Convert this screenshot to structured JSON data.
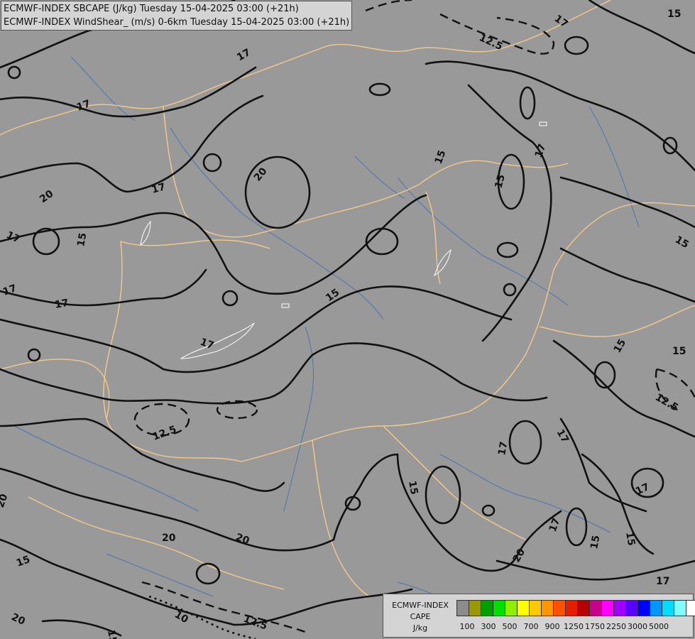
{
  "header": {
    "line1": "ECMWF-INDEX SBCAPE (J/kg) Tuesday 15-04-2025 03:00 (+21h)",
    "line2": "ECMWF-INDEX WindShear_ (m/s) 0-6km Tuesday 15-04-2025 03:00 (+21h)"
  },
  "map": {
    "background_color": "#999999",
    "border_color": "#f5c98a",
    "river_color": "#3f6fb0",
    "contour_color": "#111111",
    "contour_labels": [
      "17",
      "15",
      "12.5",
      "17",
      "17",
      "20",
      "15",
      "17",
      "17",
      "15",
      "20",
      "17",
      "15",
      "17",
      "15",
      "15",
      "17",
      "17",
      "12.5",
      "15",
      "15",
      "12.5",
      "17",
      "15",
      "17",
      "17",
      "20",
      "20",
      "20",
      "15",
      "20",
      "10",
      "12.5",
      "15",
      "20",
      "17",
      "15",
      "15",
      "17"
    ]
  },
  "legend": {
    "title_line1": "ECMWF-INDEX",
    "title_line2": "CAPE",
    "title_line3": "J/kg",
    "colors": [
      "#8c8c8c",
      "#9a9a00",
      "#00a000",
      "#00e000",
      "#90ee00",
      "#ffff00",
      "#ffc800",
      "#ff9600",
      "#ff5000",
      "#e61e00",
      "#b40000",
      "#c8008c",
      "#ff00ff",
      "#a000ff",
      "#5a00ff",
      "#0000ff",
      "#0096ff",
      "#00dcff",
      "#80ffff",
      "#ffffff"
    ],
    "ticks": [
      "100",
      "300",
      "500",
      "700",
      "900",
      "1250",
      "1750",
      "2250",
      "3000",
      "5000"
    ]
  }
}
